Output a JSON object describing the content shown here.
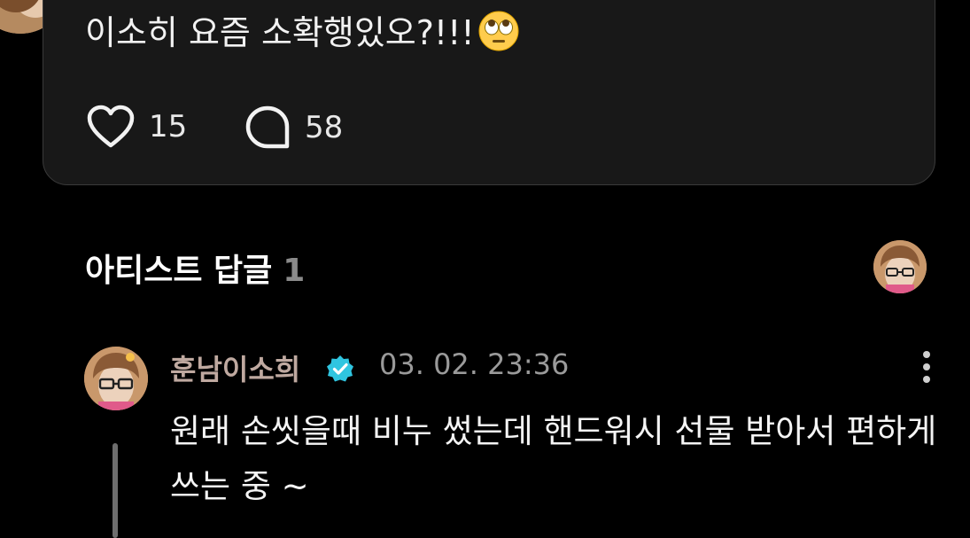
{
  "post": {
    "text": "이소히 요즘 소확행있오?!!!",
    "emoji": "face-with-rolling-eyes-icon",
    "likes": "15",
    "comments": "58"
  },
  "section": {
    "title": "아티스트 답글",
    "count": "1"
  },
  "reply": {
    "author": "훈남이소희",
    "timestamp": "03. 02. 23:36",
    "text": "원래 손씻을때 비누 썼는데 핸드워시 선물 받아서 편하게 쓰는 중 ~"
  },
  "colors": {
    "background": "#000000",
    "card": "#181818",
    "author": "#bfa9a0",
    "verified": "#2fc5e0",
    "muted": "#9a9a9a"
  }
}
